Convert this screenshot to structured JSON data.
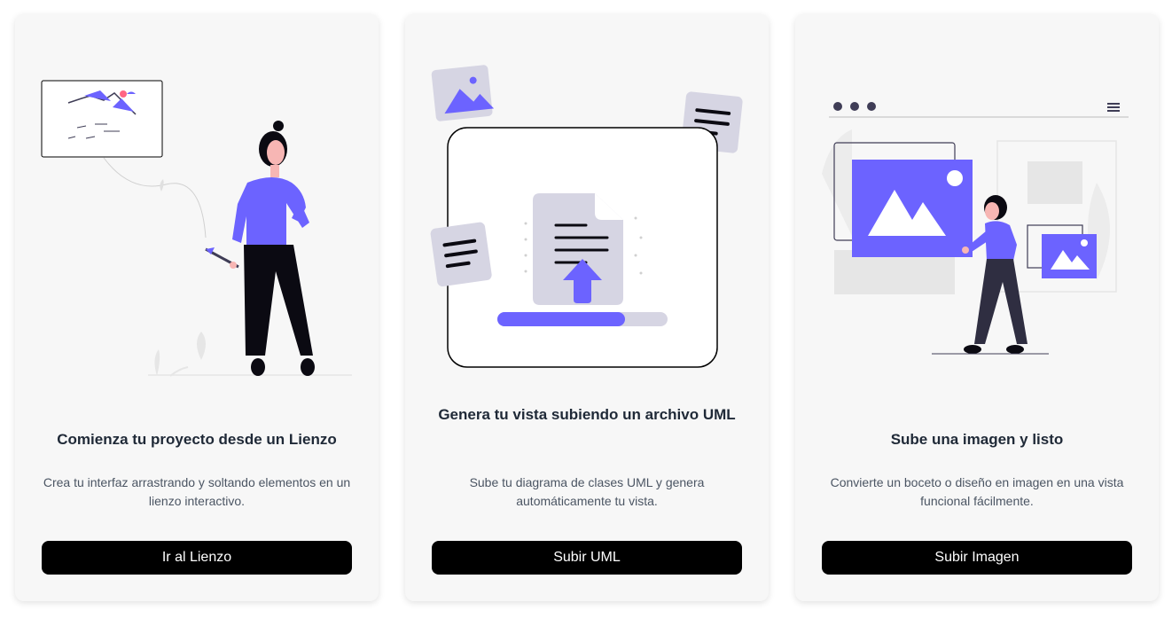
{
  "colors": {
    "accent": "#6c63ff",
    "dark": "#0b0a12",
    "card_bg": "#f7f7f7",
    "button_bg": "#000000"
  },
  "cards": [
    {
      "illustration": "woman-painting-canvas-illustration",
      "title": "Comienza tu proyecto desde un Lienzo",
      "description": "Crea tu interfaz arrastrando y soltando elementos en un lienzo interactivo.",
      "button_label": "Ir al Lienzo"
    },
    {
      "illustration": "document-upload-illustration",
      "title": "Genera tu vista subiendo un archivo UML",
      "description": "Sube tu diagrama de clases UML y genera automáticamente tu vista.",
      "button_label": "Subir UML",
      "progress": 0.75
    },
    {
      "illustration": "woman-arranging-images-illustration",
      "title": "Sube una imagen y listo",
      "description": "Convierte un boceto o diseño en imagen en una vista funcional fácilmente.",
      "button_label": "Subir Imagen"
    }
  ]
}
